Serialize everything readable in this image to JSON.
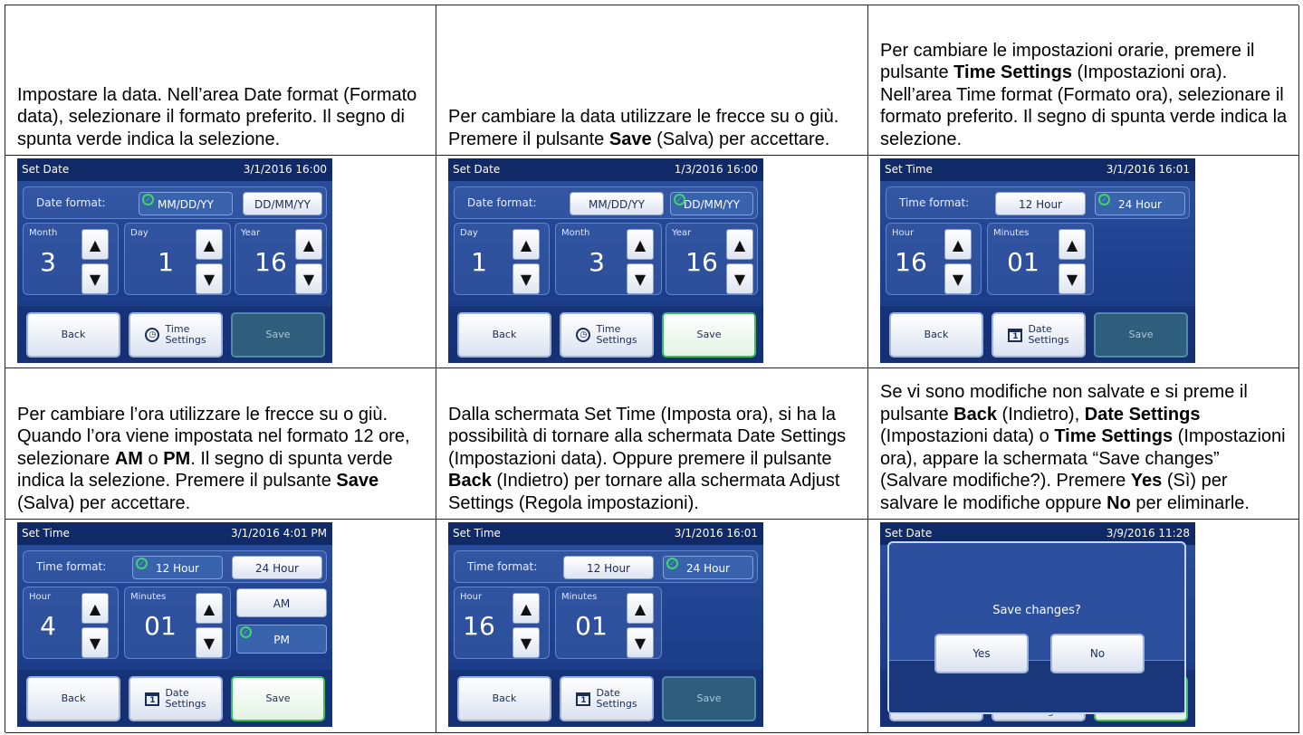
{
  "texts": {
    "c1": [
      "Impostare la data. Nell’area Date format (Formato data), selezionare il formato preferito. Il segno di spunta verde indica la selezione."
    ],
    "c2": [
      "Per cambiare la data utilizzare le frecce su o giù. Premere il pulsante ",
      "Save",
      " (Salva) per accettare."
    ],
    "c3": [
      "Per cambiare le impostazioni orarie, premere il pulsante ",
      "Time Settings",
      " (Impostazioni ora). Nell’area Time format (Formato ora), selezionare il formato preferito. Il segno di spunta verde indica la selezione."
    ],
    "c4": [
      "Per cambiare l’ora utilizzare le frecce su o giù. Quando l’ora viene impostata nel formato 12 ore, selezionare ",
      "AM",
      " o ",
      "PM",
      ". Il segno di spunta verde indica la selezione. Premere il pulsante ",
      "Save",
      " (Salva) per accettare."
    ],
    "c5": [
      "Dalla schermata Set Time (Imposta ora), si ha la possibilità di tornare alla schermata Date Settings (Impostazioni data). Oppure premere il pulsante ",
      "Back",
      " (Indietro) per tornare alla schermata Adjust Settings (Regola impostazioni)."
    ],
    "c6": [
      "Se vi sono modifiche non salvate e si preme il pulsante ",
      "Back",
      " (Indietro), ",
      "Date Settings",
      " (Impostazioni data) o ",
      "Time Settings",
      " (Impostazioni ora), appare la schermata “Save changes” (Salvare modifiche?). Premere ",
      "Yes",
      " (Sì) per salvare le modifiche oppure ",
      "No",
      " per eliminarle."
    ]
  },
  "s1": {
    "title": "Set Date",
    "time": "3/1/2016 16:00",
    "format_label": "Date format:",
    "fmt_a": "MM/DD/YY",
    "fmt_b": "DD/MM/YY",
    "v1_label": "Month",
    "v1": "3",
    "v2_label": "Day",
    "v2": "1",
    "v3_label": "Year",
    "v3": "16",
    "back": "Back",
    "mid_l1": "Time",
    "mid_l2": "Settings",
    "save": "Save"
  },
  "s2": {
    "title": "Set Date",
    "time": "1/3/2016 16:00",
    "format_label": "Date format:",
    "fmt_a": "MM/DD/YY",
    "fmt_b": "DD/MM/YY",
    "v1_label": "Day",
    "v1": "1",
    "v2_label": "Month",
    "v2": "3",
    "v3_label": "Year",
    "v3": "16",
    "back": "Back",
    "mid_l1": "Time",
    "mid_l2": "Settings",
    "save": "Save"
  },
  "s3": {
    "title": "Set Time",
    "time": "3/1/2016 16:01",
    "format_label": "Time format:",
    "fmt_a": "12 Hour",
    "fmt_b": "24 Hour",
    "v1_label": "Hour",
    "v1": "16",
    "v2_label": "Minutes",
    "v2": "01",
    "back": "Back",
    "mid_l1": "Date",
    "mid_l2": "Settings",
    "save": "Save",
    "cal_day": "1"
  },
  "s4": {
    "title": "Set Time",
    "time": "3/1/2016 4:01 PM",
    "format_label": "Time format:",
    "fmt_a": "12 Hour",
    "fmt_b": "24 Hour",
    "v1_label": "Hour",
    "v1": "4",
    "v2_label": "Minutes",
    "v2": "01",
    "am": "AM",
    "pm": "PM",
    "back": "Back",
    "mid_l1": "Date",
    "mid_l2": "Settings",
    "save": "Save",
    "cal_day": "1"
  },
  "s5": {
    "title": "Set Time",
    "time": "3/1/2016 16:01",
    "format_label": "Time format:",
    "fmt_a": "12 Hour",
    "fmt_b": "24 Hour",
    "v1_label": "Hour",
    "v1": "16",
    "v2_label": "Minutes",
    "v2": "01",
    "back": "Back",
    "mid_l1": "Date",
    "mid_l2": "Settings",
    "save": "Save",
    "cal_day": "1"
  },
  "s6": {
    "title": "Set Date",
    "time": "3/9/2016 11:28",
    "message": "Save changes?",
    "yes": "Yes",
    "no": "No",
    "behind": "Settings"
  },
  "icons": {
    "check": "check-icon",
    "up": "arrow-up-icon",
    "down": "arrow-down-icon",
    "clock": "clock-icon",
    "calendar": "calendar-icon"
  },
  "colors": {
    "screen_bg": "#1d3f8c",
    "title_bg": "#0f2a66",
    "check_green": "#3ed66a",
    "save_active_border": "#37c15a"
  }
}
